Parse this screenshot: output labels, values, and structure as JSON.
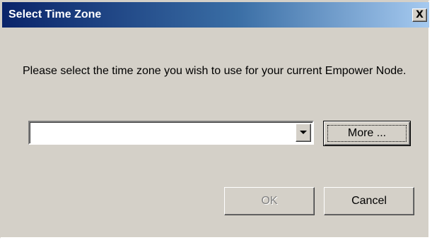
{
  "window": {
    "title": "Select Time Zone",
    "close_symbol": "X"
  },
  "message": "Please select the time zone you wish to use for your current Empower Node.",
  "time_zone_select": {
    "selected_value": "",
    "arrow_icon": "chevron-down-icon"
  },
  "buttons": {
    "more_label": "More ...",
    "ok_label": "OK",
    "ok_enabled": false,
    "cancel_label": "Cancel"
  },
  "colors": {
    "dialog_background": "#d4d0c8",
    "titlebar_start": "#0a246a",
    "titlebar_end": "#a6caf0",
    "disabled_text": "#808080"
  }
}
